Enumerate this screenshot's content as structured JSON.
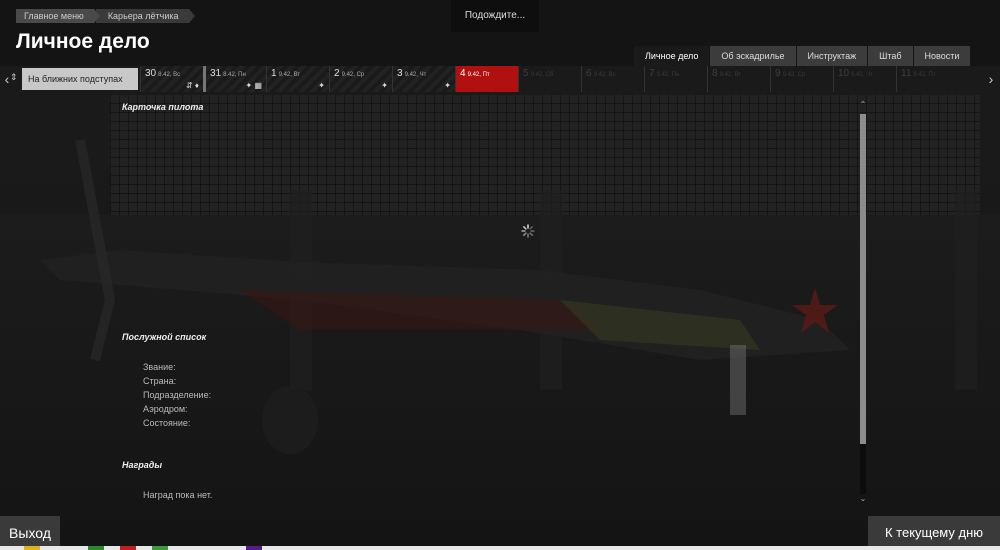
{
  "breadcrumb": [
    "Главное меню",
    "Карьера лётчика"
  ],
  "page_title": "Личное дело",
  "wait_text": "Подождите...",
  "tabs": [
    {
      "label": "Личное дело",
      "active": true
    },
    {
      "label": "Об эскадрилье",
      "active": false
    },
    {
      "label": "Инструктаж",
      "active": false
    },
    {
      "label": "Штаб",
      "active": false
    },
    {
      "label": "Новости",
      "active": false
    }
  ],
  "date_strip": {
    "filter_label": "На ближних подступах",
    "days": [
      {
        "day": "30",
        "meta": "8.42, Вс",
        "state": "past",
        "icon": "⇵ ♦"
      },
      {
        "day": "31",
        "meta": "8.42, Пн",
        "state": "past",
        "icon": "✦ ▦"
      },
      {
        "day": "1",
        "meta": "9.42, Вт",
        "state": "past",
        "icon": "✦"
      },
      {
        "day": "2",
        "meta": "9.42, Ср",
        "state": "past",
        "icon": "✦"
      },
      {
        "day": "3",
        "meta": "9.42, Чт",
        "state": "past",
        "icon": "✦"
      },
      {
        "day": "4",
        "meta": "9.42, Пт",
        "state": "today",
        "icon": ""
      },
      {
        "day": "5",
        "meta": "9.42, Сб",
        "state": "future",
        "icon": ""
      },
      {
        "day": "6",
        "meta": "9.42, Вс",
        "state": "future",
        "icon": ""
      },
      {
        "day": "7",
        "meta": "9.42, Пн",
        "state": "future",
        "icon": ""
      },
      {
        "day": "8",
        "meta": "9.42, Вт",
        "state": "future",
        "icon": ""
      },
      {
        "day": "9",
        "meta": "9.42, Ср",
        "state": "future",
        "icon": ""
      },
      {
        "day": "10",
        "meta": "9.42, Чт",
        "state": "future",
        "icon": ""
      },
      {
        "day": "11",
        "meta": "9.42, Пт",
        "state": "future",
        "icon": ""
      }
    ]
  },
  "sections": {
    "pilot_card": "Карточка пилота",
    "service_record": "Послужной список",
    "awards": "Награды",
    "no_awards": "Наград пока нет."
  },
  "service_fields": [
    "Звание:",
    "Страна:",
    "Подразделение:",
    "Аэродром:",
    "Состояние:"
  ],
  "buttons": {
    "exit": "Выход",
    "to_today": "К текущему дню"
  },
  "colors": {
    "accent_red": "#b01010",
    "panel": "#3a3a3a"
  }
}
